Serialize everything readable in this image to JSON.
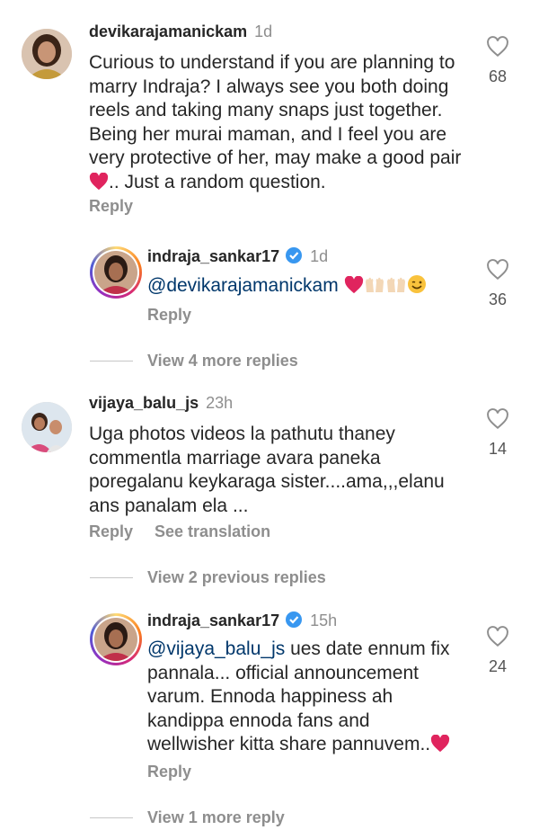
{
  "comments": [
    {
      "username": "devikarajamanickam",
      "time": "1d",
      "text": "Curious to understand if you are planning to marry Indraja? I always see you both doing reels and taking many snaps just together. Being her murai maman, and I feel you are very protective of her, may make a good pair",
      "text_suffix": ".. Just a random question.",
      "reply_label": "Reply",
      "likes": "68"
    },
    {
      "username": "indraja_sankar17",
      "time": "1d",
      "mention": "@devikarajamanickam",
      "reply_label": "Reply",
      "likes": "36"
    },
    {
      "username": "vijaya_balu_js",
      "time": "23h",
      "text": "Uga photos videos la pathutu thaney commentla marriage avara paneka poregalanu keykaraga sister....ama,,,elanu ans panalam ela ...",
      "reply_label": "Reply",
      "see_translation": "See translation",
      "likes": "14"
    },
    {
      "username": "indraja_sankar17",
      "time": "15h",
      "mention": "@vijaya_balu_js",
      "text": "ues date ennum fix pannala... official announcement varum. Ennoda happiness ah kandippa ennoda fans and wellwisher kitta share pannuvem..",
      "reply_label": "Reply",
      "likes": "24"
    }
  ],
  "view_more": {
    "first": "View 4 more replies",
    "second": "View 2 previous replies",
    "third": "View 1 more reply"
  },
  "colors": {
    "heart": "#e0245e",
    "verified": "#3897f0",
    "mention": "#00376b"
  }
}
